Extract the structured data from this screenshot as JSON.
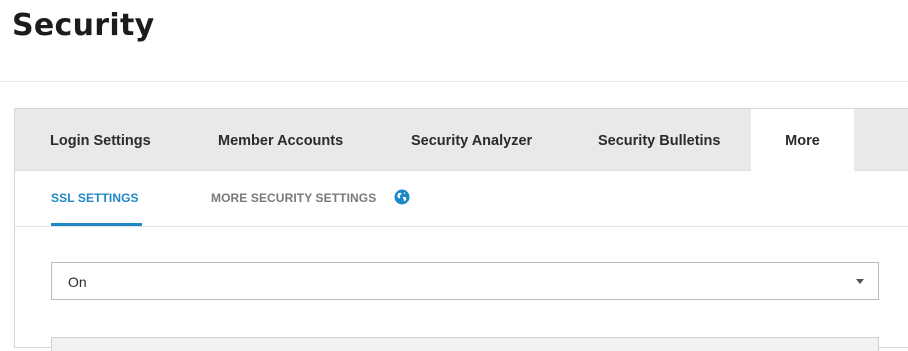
{
  "page": {
    "title": "Security"
  },
  "tabs": [
    {
      "label": "Login Settings",
      "active": false
    },
    {
      "label": "Member Accounts",
      "active": false
    },
    {
      "label": "Security Analyzer",
      "active": false
    },
    {
      "label": "Security Bulletins",
      "active": false
    },
    {
      "label": "More",
      "active": true
    }
  ],
  "subtabs": [
    {
      "label": "SSL SETTINGS",
      "active": true
    },
    {
      "label": "MORE SECURITY SETTINGS",
      "active": false,
      "icon": "globe-icon"
    }
  ],
  "ssl_select": {
    "value": "On"
  },
  "colors": {
    "accent": "#1e88c7",
    "tab_bar_bg": "#e9e9e9",
    "title": "#1c1c1c"
  }
}
